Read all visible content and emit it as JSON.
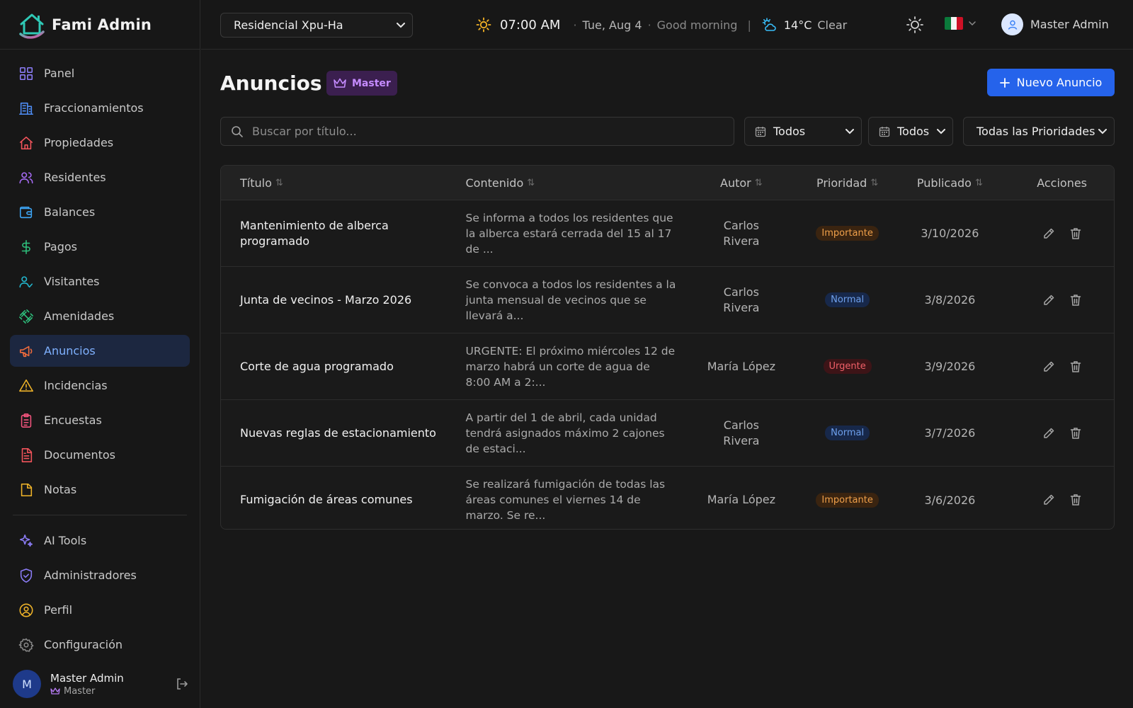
{
  "app": {
    "name": "Fami Admin"
  },
  "sidebar": {
    "items": [
      {
        "label": "Panel",
        "icon": "dashboard-icon",
        "color": "#8b7cf6"
      },
      {
        "label": "Fraccionamientos",
        "icon": "building-icon",
        "color": "#4f8ef7"
      },
      {
        "label": "Propiedades",
        "icon": "home-icon",
        "color": "#f2545b"
      },
      {
        "label": "Residentes",
        "icon": "users-icon",
        "color": "#a66bf5"
      },
      {
        "label": "Balances",
        "icon": "wallet-icon",
        "color": "#3da5f5"
      },
      {
        "label": "Pagos",
        "icon": "dollar-icon",
        "color": "#2ec27e"
      },
      {
        "label": "Visitantes",
        "icon": "user-check-icon",
        "color": "#22b8cf"
      },
      {
        "label": "Amenidades",
        "icon": "dumbbell-icon",
        "color": "#2ec27e"
      },
      {
        "label": "Anuncios",
        "icon": "megaphone-icon",
        "color": "#f06b3c",
        "active": true
      },
      {
        "label": "Incidencias",
        "icon": "warning-icon",
        "color": "#f0b429"
      },
      {
        "label": "Encuestas",
        "icon": "clipboard-icon",
        "color": "#f2547d"
      },
      {
        "label": "Documentos",
        "icon": "document-icon",
        "color": "#f2545b"
      },
      {
        "label": "Notas",
        "icon": "note-icon",
        "color": "#f0b429"
      }
    ],
    "secondary": [
      {
        "label": "AI Tools",
        "icon": "sparkles-icon",
        "color": "#8b7cf6"
      },
      {
        "label": "Administradores",
        "icon": "shield-icon",
        "color": "#8b7cf6"
      },
      {
        "label": "Perfil",
        "icon": "user-circle-icon",
        "color": "#f0b429"
      },
      {
        "label": "Configuración",
        "icon": "gear-icon",
        "color": "#8a8a8a"
      }
    ],
    "user": {
      "initial": "M",
      "name": "Master Admin",
      "role": "Master"
    }
  },
  "topbar": {
    "residence": "Residencial Xpu-Ha",
    "time": "07:00 AM",
    "date": "Tue, Aug 4",
    "greeting": "Good morning",
    "temperature": "14°C",
    "weather": "Clear",
    "user_name": "Master Admin"
  },
  "page": {
    "title": "Anuncios",
    "badge": "Master",
    "new_button": "Nuevo Anuncio",
    "search_placeholder": "Buscar por título...",
    "filter1": "Todos",
    "filter2": "Todos",
    "filter3": "Todas las Prioridades"
  },
  "table": {
    "columns": [
      "Título",
      "Contenido",
      "Autor",
      "Prioridad",
      "Publicado",
      "Acciones"
    ],
    "rows": [
      {
        "title": "Mantenimiento de alberca programado",
        "content": "Se informa a todos los residentes que la alberca estará cerrada del 15 al 17 de ...",
        "author": "Carlos Rivera",
        "priority": "Importante",
        "priority_kind": "imp",
        "date": "3/10/2026"
      },
      {
        "title": "Junta de vecinos - Marzo 2026",
        "content": "Se convoca a todos los residentes a la junta mensual de vecinos que se llevará a...",
        "author": "Carlos Rivera",
        "priority": "Normal",
        "priority_kind": "norm",
        "date": "3/8/2026"
      },
      {
        "title": "Corte de agua programado",
        "content": "URGENTE: El próximo miércoles 12 de marzo habrá un corte de agua de 8:00 AM a 2:...",
        "author": "María López",
        "priority": "Urgente",
        "priority_kind": "urg",
        "date": "3/9/2026"
      },
      {
        "title": "Nuevas reglas de estacionamiento",
        "content": "A partir del 1 de abril, cada unidad tendrá asignados máximo 2 cajones de estaci...",
        "author": "Carlos Rivera",
        "priority": "Normal",
        "priority_kind": "norm",
        "date": "3/7/2026"
      },
      {
        "title": "Fumigación de áreas comunes",
        "content": "Se realizará fumigación de todas las áreas comunes el viernes 14 de marzo. Se re...",
        "author": "María López",
        "priority": "Importante",
        "priority_kind": "imp",
        "date": "3/6/2026"
      }
    ]
  }
}
